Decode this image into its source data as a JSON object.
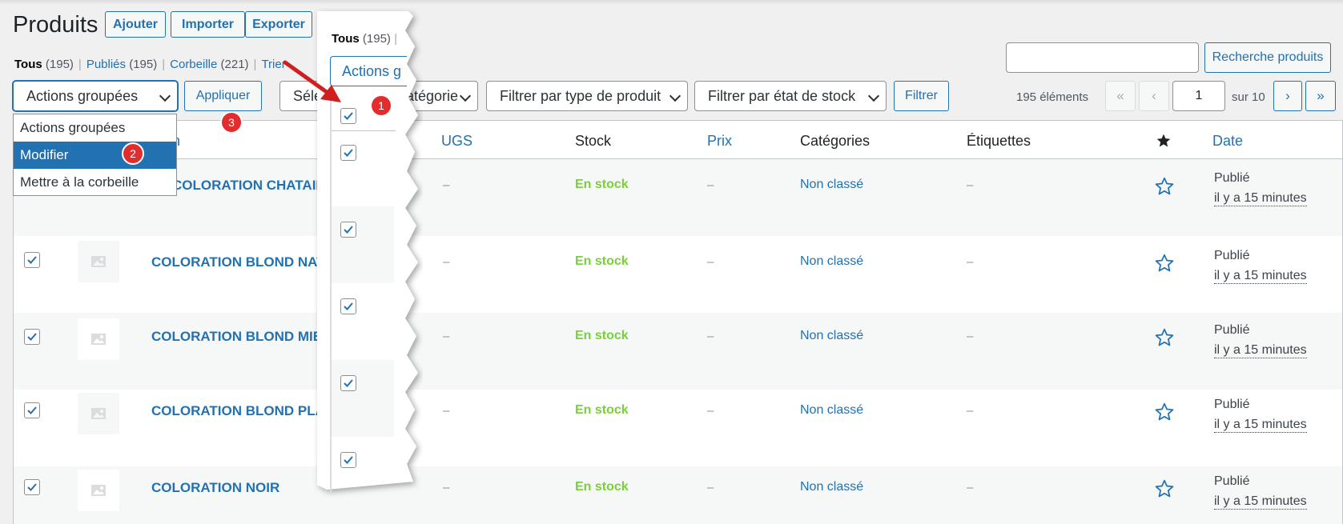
{
  "header": {
    "title": "Produits",
    "buttons": [
      "Ajouter",
      "Importer",
      "Exporter"
    ]
  },
  "subsubsub": {
    "all": "Tous",
    "all_count": "(195)",
    "published": "Publiés",
    "published_count": "(195)",
    "trash": "Corbeille",
    "trash_count": "(221)",
    "sort": "Trier",
    "sep": "|"
  },
  "bulk": {
    "select_value": "Actions groupées",
    "apply": "Appliquer",
    "options": [
      "Actions groupées",
      "Modifier",
      "Mettre à la corbeille"
    ]
  },
  "filters": {
    "category_partial_left": "Séle",
    "category_partial_right": "catégorie",
    "type": "Filtrer par type de produit",
    "stock": "Filtrer par état de stock",
    "filter_btn": "Filtrer"
  },
  "search": {
    "button": "Recherche produits",
    "value": ""
  },
  "pagination": {
    "count": "195 éléments",
    "first": "«",
    "prev": "‹",
    "current": "1",
    "of": "sur 10",
    "next": "›",
    "last": "»"
  },
  "table": {
    "headers": {
      "name_partial": "n",
      "sku": "UGS",
      "stock": "Stock",
      "price": "Prix",
      "categories": "Catégories",
      "tags": "Étiquettes",
      "date": "Date"
    },
    "rows": [
      {
        "name": "COLORATION CHATAIN AU",
        "stock": "En stock",
        "sku": "–",
        "price": "–",
        "category": "Non classé",
        "tags": "–",
        "status": "Publié",
        "time": "il y a 15 minutes"
      },
      {
        "name": "COLORATION BLOND NAT",
        "stock": "En stock",
        "sku": "–",
        "price": "–",
        "category": "Non classé",
        "tags": "–",
        "status": "Publié",
        "time": "il y a 15 minutes"
      },
      {
        "name": "COLORATION BLOND MIE",
        "stock": "En stock",
        "sku": "–",
        "price": "–",
        "category": "Non classé",
        "tags": "–",
        "status": "Publié",
        "time": "il y a 15 minutes"
      },
      {
        "name": "COLORATION BLOND PLA",
        "stock": "En stock",
        "sku": "–",
        "price": "–",
        "category": "Non classé",
        "tags": "–",
        "status": "Publié",
        "time": "il y a 15 minutes"
      },
      {
        "name": "COLORATION NOIR",
        "stock": "En stock",
        "sku": "–",
        "price": "–",
        "category": "Non classé",
        "tags": "–",
        "status": "Publié",
        "time": "il y a 15 minutes"
      }
    ]
  },
  "zoom": {
    "tab_all": "Tous",
    "tab_count": "(195)",
    "tab_sep": "|",
    "actions_partial": "Actions g"
  },
  "badges": [
    "1",
    "2",
    "3"
  ],
  "colors": {
    "accent": "#2271b1",
    "badge": "#e12d2d",
    "stock": "#7ad03a",
    "arrow": "#d01f1f"
  }
}
